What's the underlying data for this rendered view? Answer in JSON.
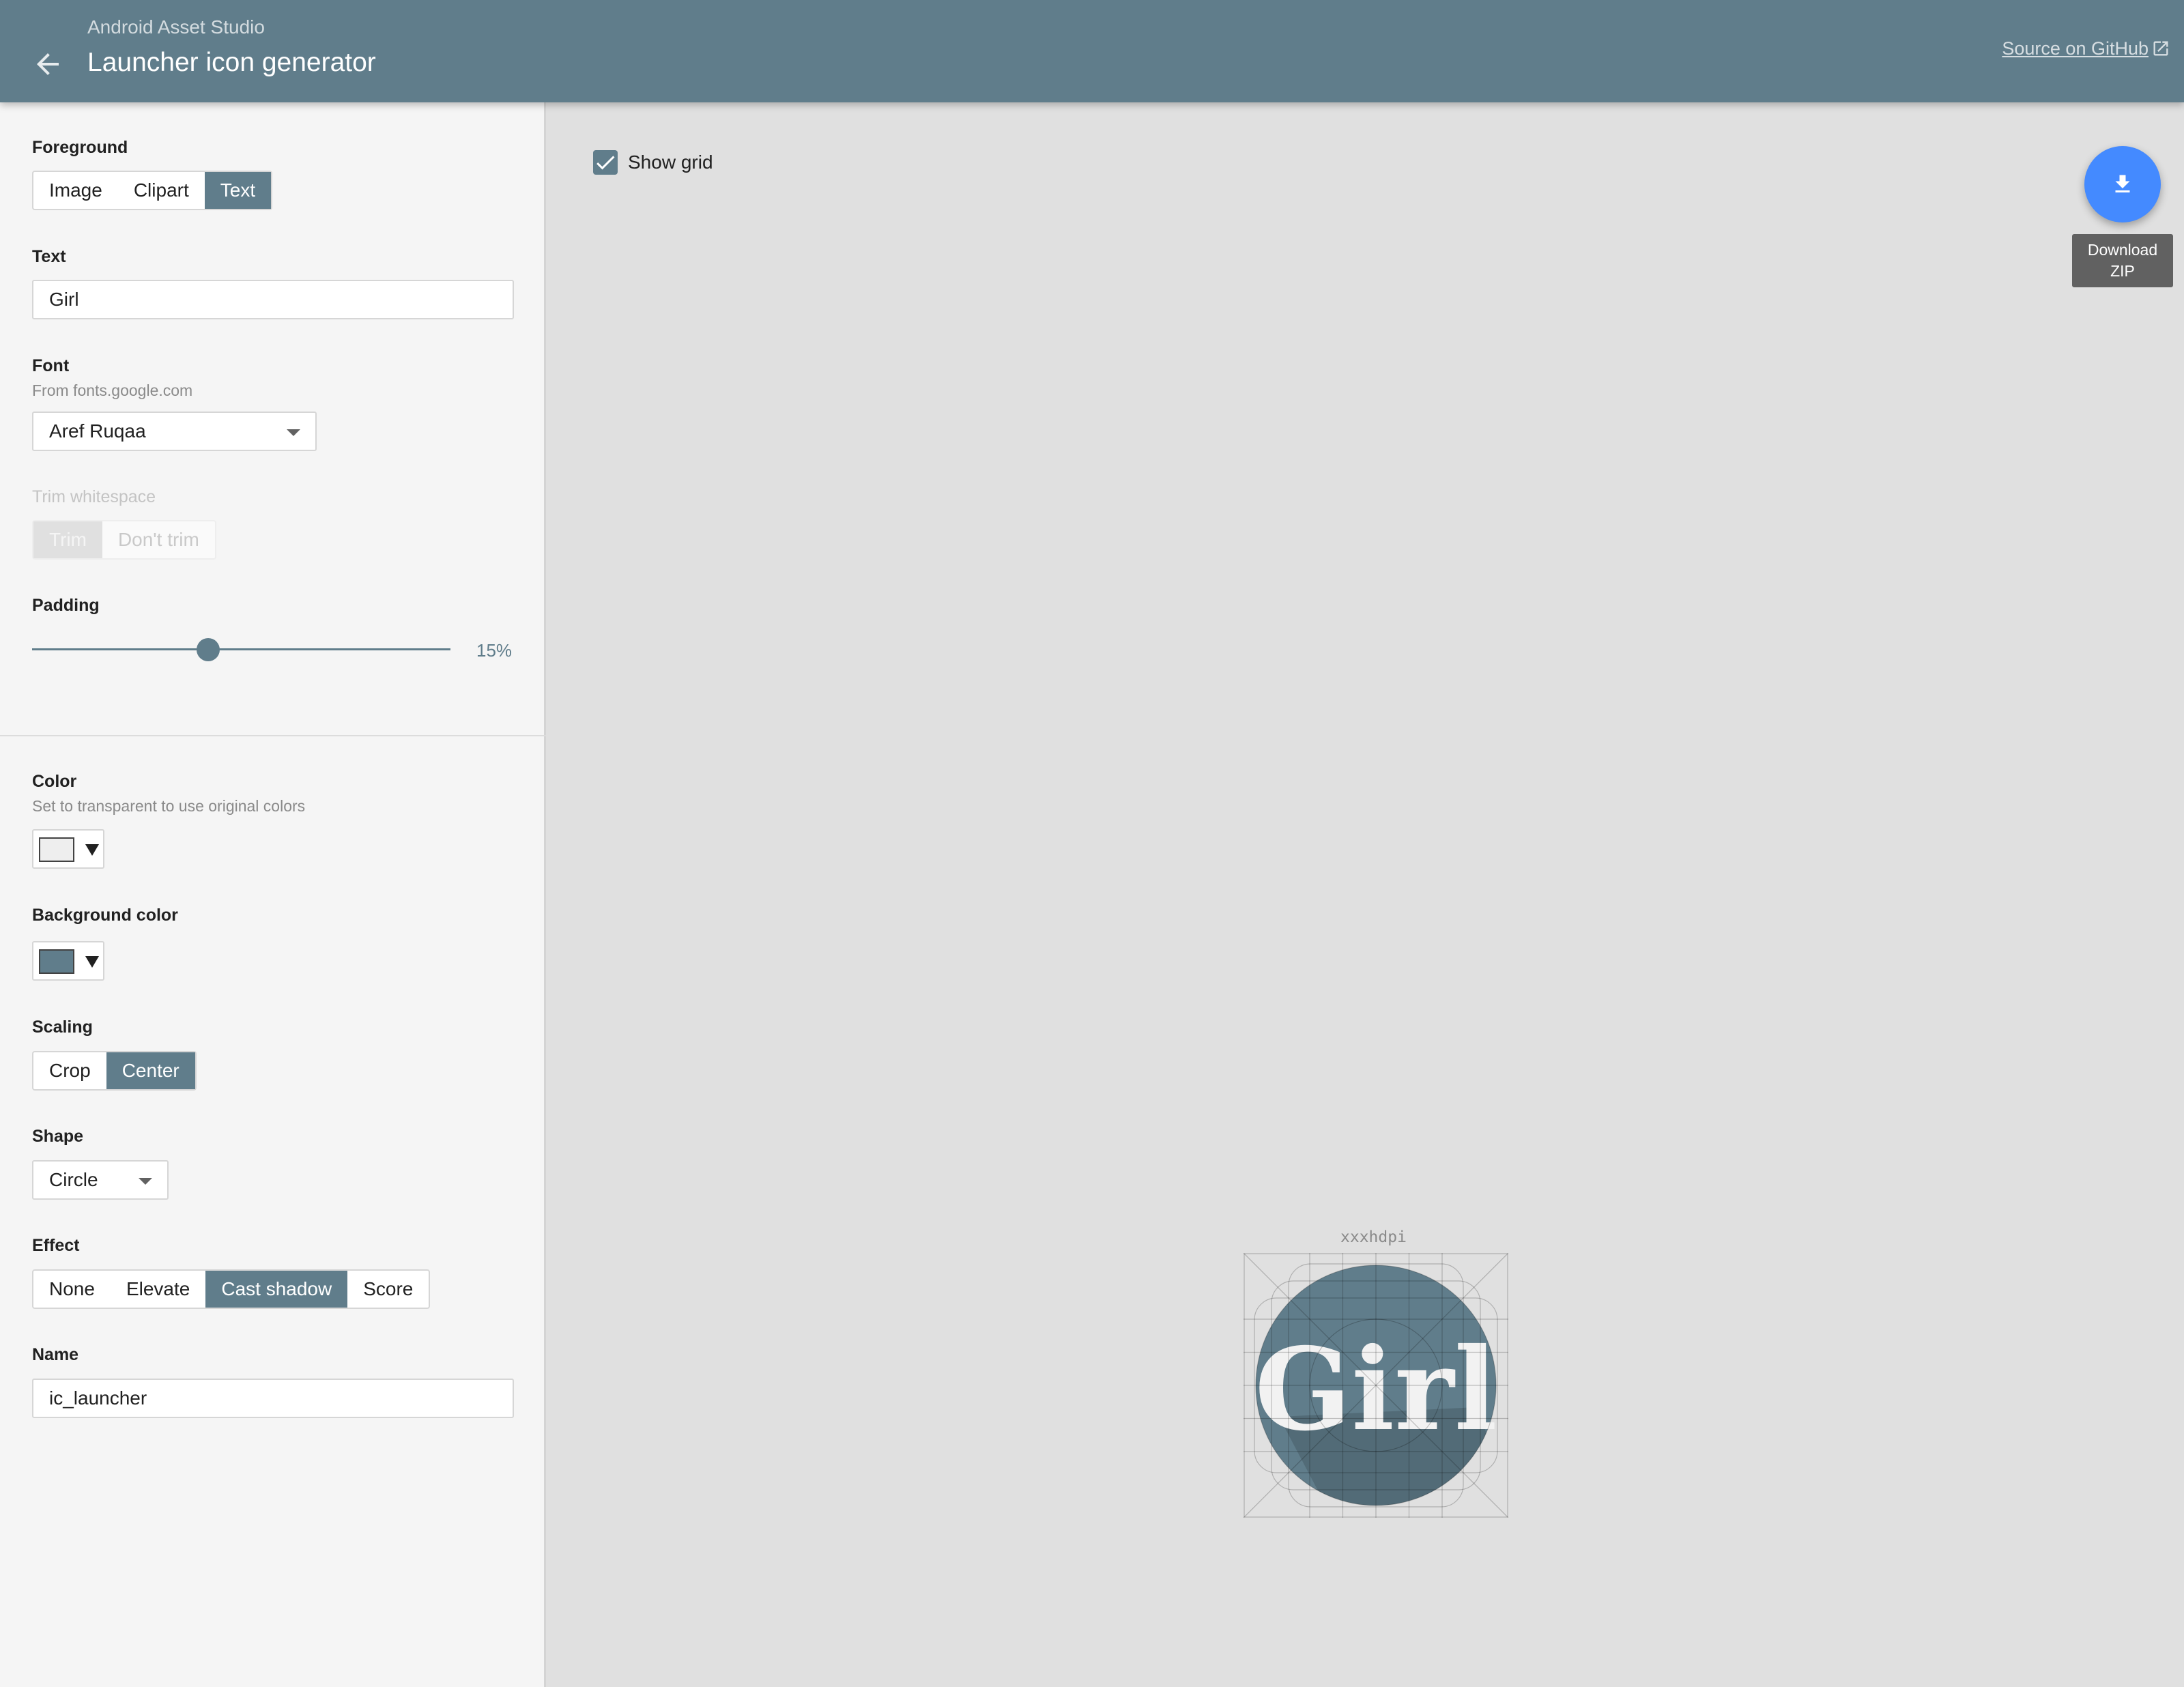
{
  "header": {
    "subtitle": "Android Asset Studio",
    "title": "Launcher icon generator",
    "github_link": "Source on GitHub"
  },
  "sidebar": {
    "foreground": {
      "label": "Foreground",
      "options": [
        "Image",
        "Clipart",
        "Text"
      ],
      "selected": "Text"
    },
    "text": {
      "label": "Text",
      "value": "Girl"
    },
    "font": {
      "label": "Font",
      "hint": "From fonts.google.com",
      "value": "Aref Ruqaa"
    },
    "trim": {
      "label": "Trim whitespace",
      "options": [
        "Trim",
        "Don't trim"
      ],
      "selected": "Trim",
      "disabled": true
    },
    "padding": {
      "label": "Padding",
      "value_text": "15%",
      "value": 15
    },
    "color": {
      "label": "Color",
      "hint": "Set to transparent to use original colors",
      "swatch": "#eeeeee"
    },
    "background_color": {
      "label": "Background color",
      "swatch": "#607d8b"
    },
    "scaling": {
      "label": "Scaling",
      "options": [
        "Crop",
        "Center"
      ],
      "selected": "Center"
    },
    "shape": {
      "label": "Shape",
      "value": "Circle"
    },
    "effect": {
      "label": "Effect",
      "options": [
        "None",
        "Elevate",
        "Cast shadow",
        "Score"
      ],
      "selected": "Cast shadow"
    },
    "name": {
      "label": "Name",
      "value": "ic_launcher"
    }
  },
  "main": {
    "show_grid": {
      "label": "Show grid",
      "checked": true
    },
    "download": {
      "line1": "Download",
      "line2": "ZIP"
    },
    "preview": {
      "density": "xxxhdpi",
      "icon_text": "Girl"
    }
  },
  "colors": {
    "primary": "#607d8b",
    "accent": "#448aff",
    "canvas": "#e0e0e0",
    "sidebar": "#f5f5f5"
  },
  "icons": [
    "arrow-back-icon",
    "open-in-new-icon",
    "download-icon",
    "check-icon",
    "dropdown-caret-icon"
  ]
}
